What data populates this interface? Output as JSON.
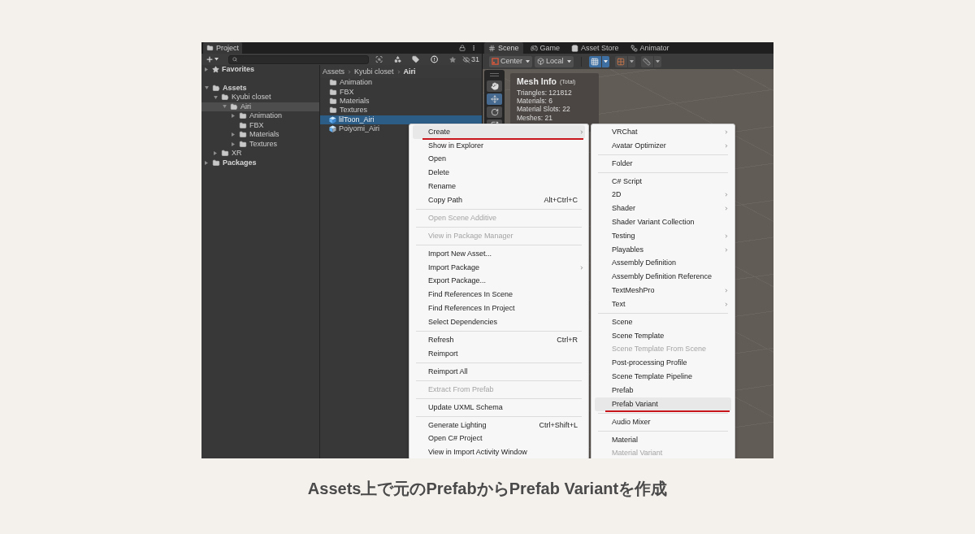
{
  "project_panel": {
    "tab": {
      "label": "Project"
    },
    "hidden_count": "31",
    "tree": [
      {
        "label": "Favorites",
        "kind": "favorites",
        "expanded": false,
        "selected": false
      },
      {
        "label": "Assets",
        "kind": "folder",
        "expanded": true,
        "selected": false,
        "children": [
          {
            "label": "Kyubi closet",
            "kind": "folder",
            "expanded": true,
            "selected": false,
            "children": [
              {
                "label": "Airi",
                "kind": "folder",
                "expanded": true,
                "selected": true,
                "children": [
                  {
                    "label": "Animation",
                    "kind": "folder",
                    "expanded": false,
                    "selected": false
                  },
                  {
                    "label": "FBX",
                    "kind": "folder",
                    "selected": false
                  },
                  {
                    "label": "Materials",
                    "kind": "folder",
                    "expanded": false,
                    "selected": false
                  },
                  {
                    "label": "Textures",
                    "kind": "folder",
                    "expanded": false,
                    "selected": false
                  }
                ]
              }
            ]
          },
          {
            "label": "XR",
            "kind": "folder",
            "expanded": false,
            "selected": false
          }
        ]
      },
      {
        "label": "Packages",
        "kind": "folder",
        "expanded": false,
        "selected": false
      }
    ],
    "breadcrumb": [
      "Assets",
      "Kyubi closet",
      "Airi"
    ],
    "files": [
      {
        "label": "Animation",
        "kind": "folder",
        "selected": false
      },
      {
        "label": "FBX",
        "kind": "folder",
        "selected": false
      },
      {
        "label": "Materials",
        "kind": "folder",
        "selected": false
      },
      {
        "label": "Textures",
        "kind": "folder",
        "selected": false
      },
      {
        "label": "lilToon_Airi",
        "kind": "prefab",
        "selected": true
      },
      {
        "label": "Poiyomi_Airi",
        "kind": "prefab_variant",
        "selected": false
      }
    ]
  },
  "scene_panel": {
    "tabs": [
      {
        "label": "Scene",
        "selected": true
      },
      {
        "label": "Game",
        "selected": false
      },
      {
        "label": "Asset Store",
        "selected": false
      },
      {
        "label": "Animator",
        "selected": false
      }
    ],
    "toolbar": {
      "pivot": "Center",
      "space": "Local",
      "toggles": [
        {
          "on": true
        },
        {
          "on": false
        },
        {
          "on": false
        }
      ]
    },
    "tools": [
      {
        "selected": false
      },
      {
        "selected": true
      },
      {
        "selected": false
      },
      {
        "selected": false
      }
    ],
    "mesh_info": {
      "title": "Mesh Info",
      "subtitle": "(Total)",
      "lines": [
        "Triangles: 121812",
        "Materials: 6",
        "Material Slots: 22",
        "Meshes: 21"
      ]
    }
  },
  "context_menu": {
    "items": [
      {
        "kind": "item",
        "label": "Create",
        "selected": true,
        "underlined": true,
        "disabled": false,
        "submenu": true
      },
      {
        "kind": "item",
        "label": "Show in Explorer",
        "selected": false,
        "underlined": false,
        "disabled": false,
        "submenu": false
      },
      {
        "kind": "item",
        "label": "Open",
        "selected": false,
        "underlined": false,
        "disabled": false,
        "submenu": false
      },
      {
        "kind": "item",
        "label": "Delete",
        "selected": false,
        "underlined": false,
        "disabled": false,
        "submenu": false
      },
      {
        "kind": "item",
        "label": "Rename",
        "selected": false,
        "underlined": false,
        "disabled": false,
        "submenu": false
      },
      {
        "kind": "item",
        "label": "Copy Path",
        "shortcut": "Alt+Ctrl+C",
        "selected": false,
        "underlined": false,
        "disabled": false,
        "submenu": false
      },
      {
        "kind": "separator"
      },
      {
        "kind": "item",
        "label": "Open Scene Additive",
        "selected": false,
        "underlined": false,
        "disabled": true,
        "submenu": false
      },
      {
        "kind": "separator"
      },
      {
        "kind": "item",
        "label": "View in Package Manager",
        "selected": false,
        "underlined": false,
        "disabled": true,
        "submenu": false
      },
      {
        "kind": "separator"
      },
      {
        "kind": "item",
        "label": "Import New Asset...",
        "selected": false,
        "underlined": false,
        "disabled": false,
        "submenu": false
      },
      {
        "kind": "item",
        "label": "Import Package",
        "selected": false,
        "underlined": false,
        "disabled": false,
        "submenu": true
      },
      {
        "kind": "item",
        "label": "Export Package...",
        "selected": false,
        "underlined": false,
        "disabled": false,
        "submenu": false
      },
      {
        "kind": "item",
        "label": "Find References In Scene",
        "selected": false,
        "underlined": false,
        "disabled": false,
        "submenu": false
      },
      {
        "kind": "item",
        "label": "Find References In Project",
        "selected": false,
        "underlined": false,
        "disabled": false,
        "submenu": false
      },
      {
        "kind": "item",
        "label": "Select Dependencies",
        "selected": false,
        "underlined": false,
        "disabled": false,
        "submenu": false
      },
      {
        "kind": "separator"
      },
      {
        "kind": "item",
        "label": "Refresh",
        "shortcut": "Ctrl+R",
        "selected": false,
        "underlined": false,
        "disabled": false,
        "submenu": false
      },
      {
        "kind": "item",
        "label": "Reimport",
        "selected": false,
        "underlined": false,
        "disabled": false,
        "submenu": false
      },
      {
        "kind": "separator"
      },
      {
        "kind": "item",
        "label": "Reimport All",
        "selected": false,
        "underlined": false,
        "disabled": false,
        "submenu": false
      },
      {
        "kind": "separator"
      },
      {
        "kind": "item",
        "label": "Extract From Prefab",
        "selected": false,
        "underlined": false,
        "disabled": true,
        "submenu": false
      },
      {
        "kind": "separator"
      },
      {
        "kind": "item",
        "label": "Update UXML Schema",
        "selected": false,
        "underlined": false,
        "disabled": false,
        "submenu": false
      },
      {
        "kind": "separator"
      },
      {
        "kind": "item",
        "label": "Generate Lighting",
        "shortcut": "Ctrl+Shift+L",
        "selected": false,
        "underlined": false,
        "disabled": false,
        "submenu": false
      },
      {
        "kind": "item",
        "label": "Open C# Project",
        "selected": false,
        "underlined": false,
        "disabled": false,
        "submenu": false
      },
      {
        "kind": "item",
        "label": "View in Import Activity Window",
        "selected": false,
        "underlined": false,
        "disabled": false,
        "submenu": false
      }
    ]
  },
  "submenu": {
    "items": [
      {
        "kind": "item",
        "label": "VRChat",
        "selected": false,
        "underlined": false,
        "disabled": false,
        "submenu": true
      },
      {
        "kind": "item",
        "label": "Avatar Optimizer",
        "selected": false,
        "underlined": false,
        "disabled": false,
        "submenu": true
      },
      {
        "kind": "separator"
      },
      {
        "kind": "item",
        "label": "Folder",
        "selected": false,
        "underlined": false,
        "disabled": false,
        "submenu": false
      },
      {
        "kind": "separator"
      },
      {
        "kind": "item",
        "label": "C# Script",
        "selected": false,
        "underlined": false,
        "disabled": false,
        "submenu": false
      },
      {
        "kind": "item",
        "label": "2D",
        "selected": false,
        "underlined": false,
        "disabled": false,
        "submenu": true
      },
      {
        "kind": "item",
        "label": "Shader",
        "selected": false,
        "underlined": false,
        "disabled": false,
        "submenu": true
      },
      {
        "kind": "item",
        "label": "Shader Variant Collection",
        "selected": false,
        "underlined": false,
        "disabled": false,
        "submenu": false
      },
      {
        "kind": "item",
        "label": "Testing",
        "selected": false,
        "underlined": false,
        "disabled": false,
        "submenu": true
      },
      {
        "kind": "item",
        "label": "Playables",
        "selected": false,
        "underlined": false,
        "disabled": false,
        "submenu": true
      },
      {
        "kind": "item",
        "label": "Assembly Definition",
        "selected": false,
        "underlined": false,
        "disabled": false,
        "submenu": false
      },
      {
        "kind": "item",
        "label": "Assembly Definition Reference",
        "selected": false,
        "underlined": false,
        "disabled": false,
        "submenu": false
      },
      {
        "kind": "item",
        "label": "TextMeshPro",
        "selected": false,
        "underlined": false,
        "disabled": false,
        "submenu": true
      },
      {
        "kind": "item",
        "label": "Text",
        "selected": false,
        "underlined": false,
        "disabled": false,
        "submenu": true
      },
      {
        "kind": "separator"
      },
      {
        "kind": "item",
        "label": "Scene",
        "selected": false,
        "underlined": false,
        "disabled": false,
        "submenu": false
      },
      {
        "kind": "item",
        "label": "Scene Template",
        "selected": false,
        "underlined": false,
        "disabled": false,
        "submenu": false
      },
      {
        "kind": "item",
        "label": "Scene Template From Scene",
        "selected": false,
        "underlined": false,
        "disabled": true,
        "submenu": false
      },
      {
        "kind": "item",
        "label": "Post-processing Profile",
        "selected": false,
        "underlined": false,
        "disabled": false,
        "submenu": false
      },
      {
        "kind": "item",
        "label": "Scene Template Pipeline",
        "selected": false,
        "underlined": false,
        "disabled": false,
        "submenu": false
      },
      {
        "kind": "item",
        "label": "Prefab",
        "selected": false,
        "underlined": false,
        "disabled": false,
        "submenu": false
      },
      {
        "kind": "item",
        "label": "Prefab Variant",
        "selected": true,
        "underlined": true,
        "disabled": false,
        "submenu": false
      },
      {
        "kind": "separator"
      },
      {
        "kind": "item",
        "label": "Audio Mixer",
        "selected": false,
        "underlined": false,
        "disabled": false,
        "submenu": false
      },
      {
        "kind": "separator"
      },
      {
        "kind": "item",
        "label": "Material",
        "selected": false,
        "underlined": false,
        "disabled": false,
        "submenu": false
      },
      {
        "kind": "item",
        "label": "Material Variant",
        "selected": false,
        "underlined": false,
        "disabled": true,
        "submenu": false
      }
    ]
  },
  "caption": "Assets上で元のPrefabからPrefab Variantを作成"
}
